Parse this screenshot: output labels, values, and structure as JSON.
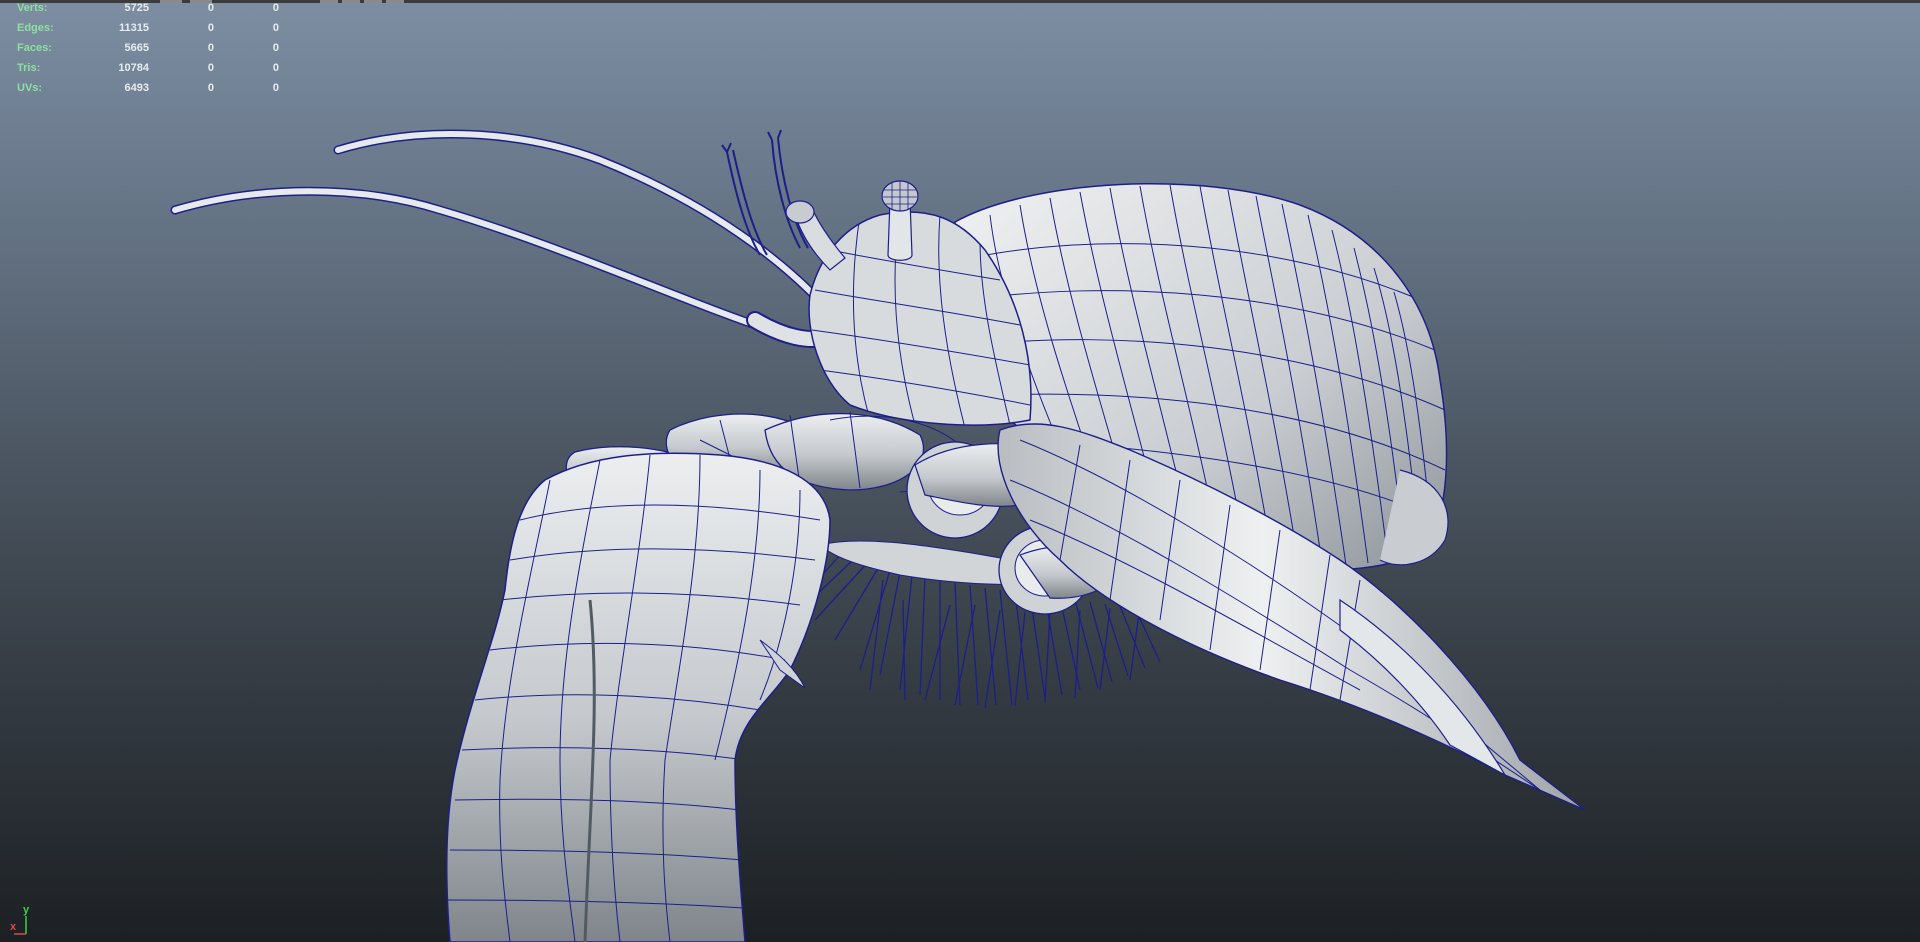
{
  "hud": {
    "rows": [
      {
        "label": "Verts:",
        "v1": "5725",
        "v2": "0",
        "v3": "0"
      },
      {
        "label": "Edges:",
        "v1": "11315",
        "v2": "0",
        "v3": "0"
      },
      {
        "label": "Faces:",
        "v1": "5665",
        "v2": "0",
        "v3": "0"
      },
      {
        "label": "Tris:",
        "v1": "10784",
        "v2": "0",
        "v3": "0"
      },
      {
        "label": "UVs:",
        "v1": "6493",
        "v2": "0",
        "v3": "0"
      }
    ]
  },
  "axis": {
    "y": "y",
    "x": "x"
  },
  "colors": {
    "wire": "#1c1f8a",
    "shade": "#d9dcde",
    "label": "#8de19e"
  }
}
